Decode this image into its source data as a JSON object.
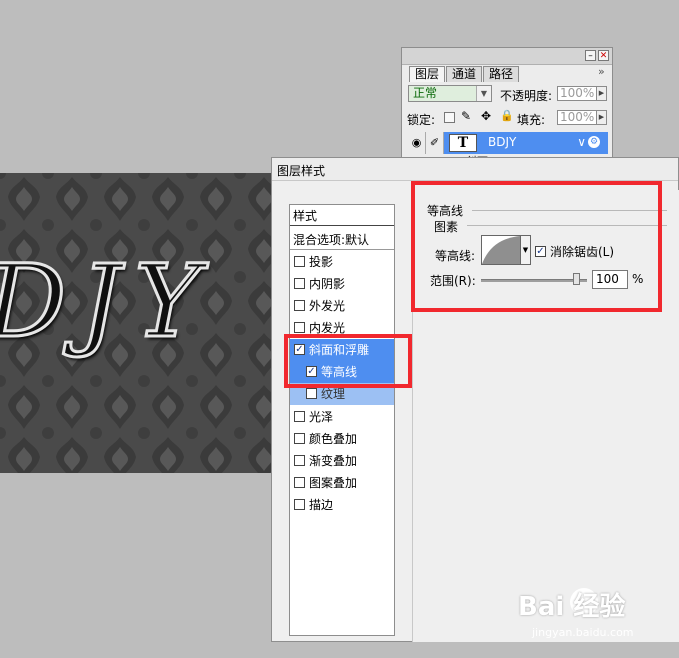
{
  "canvas": {
    "text": "DJY"
  },
  "layers_panel": {
    "tabs": [
      "图层",
      "通道",
      "路径"
    ],
    "collapse_glyph": "»",
    "blend_mode": "正常",
    "opacity_label": "不透明度:",
    "opacity_value": "100%",
    "lock_label": "锁定:",
    "fill_label": "填充:",
    "fill_value": "100%",
    "layer": {
      "thumb": "T",
      "name": "BDJY",
      "fx_label": "∨"
    },
    "partial_row": "斜面"
  },
  "dialog": {
    "title": "图层样式",
    "styles_header": "样式",
    "blend_options": "混合选项:默认",
    "items": [
      {
        "label": "投影",
        "checked": false
      },
      {
        "label": "内阴影",
        "checked": false
      },
      {
        "label": "外发光",
        "checked": false
      },
      {
        "label": "内发光",
        "checked": false
      },
      {
        "label": "斜面和浮雕",
        "checked": true
      },
      {
        "label": "等高线",
        "checked": true
      },
      {
        "label": "纹理",
        "checked": false
      },
      {
        "label": "光泽",
        "checked": false
      },
      {
        "label": "颜色叠加",
        "checked": false
      },
      {
        "label": "渐变叠加",
        "checked": false
      },
      {
        "label": "图案叠加",
        "checked": false
      },
      {
        "label": "描边",
        "checked": false
      }
    ],
    "contour_group": {
      "title": "等高线",
      "subtitle": "图素",
      "contour_label": "等高线:",
      "antialias_label": "消除锯齿(L)",
      "antialias_checked": true,
      "range_label": "范围(R):",
      "range_value": "100",
      "range_unit": "%",
      "range_fraction": 0.95
    }
  },
  "watermark": {
    "brand": "Bai 经验",
    "url": "jingyan.baidu.com"
  },
  "colors": {
    "selection": "#4e8ef0",
    "highlight_red": "#f1282e",
    "blend_text": "#0c6b0c"
  }
}
